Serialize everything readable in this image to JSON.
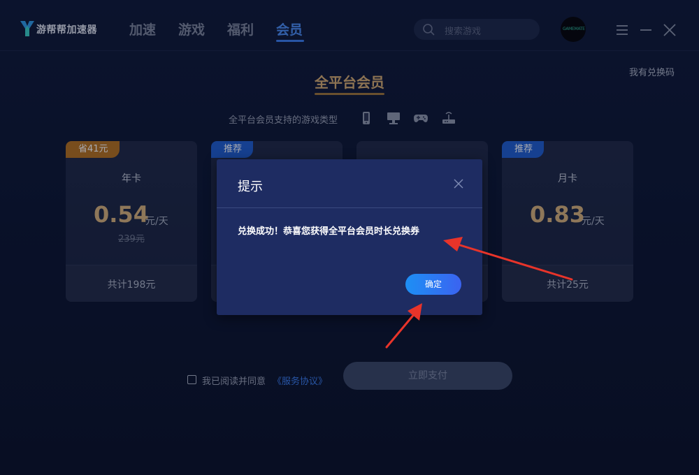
{
  "app": {
    "title": "游帮帮加速器",
    "logo_icon": "logo-y-icon"
  },
  "nav": {
    "items": [
      {
        "label": "加速",
        "active": false
      },
      {
        "label": "游戏",
        "active": false
      },
      {
        "label": "福利",
        "active": false
      },
      {
        "label": "会员",
        "active": true
      }
    ]
  },
  "search": {
    "placeholder": "搜索游戏",
    "icon": "search-icon"
  },
  "avatar": {
    "text": "GAMEMATE"
  },
  "window_controls": [
    "menu-icon",
    "minimize-icon",
    "close-icon"
  ],
  "page": {
    "redeem_link": "我有兑换码",
    "title": "全平台会员",
    "support_text": "全平台会员支持的游戏类型",
    "support_icons": [
      "mobile-icon",
      "pc-icon",
      "gamepad-icon",
      "router-icon"
    ]
  },
  "plans": [
    {
      "badge": "省41元",
      "name": "年卡",
      "price": "0.54",
      "unit": "元/天",
      "original": "239元",
      "total": "共计198元"
    },
    {
      "badge": "推荐",
      "name": "",
      "price": "",
      "unit": "",
      "original": "",
      "total": ""
    },
    {
      "badge": "",
      "name": "",
      "price": "",
      "unit": "",
      "original": "",
      "total": ""
    },
    {
      "badge": "推荐",
      "name": "月卡",
      "price": "0.83",
      "unit": "元/天",
      "original": "",
      "total": "共计25元"
    }
  ],
  "agreement": {
    "text": "我已阅读并同意",
    "link": "《服务协议》",
    "checked": false
  },
  "pay_button": "立即支付",
  "dialog": {
    "title": "提示",
    "message": "兑换成功！恭喜您获得全平台会员时长兑换券",
    "confirm": "确定"
  },
  "colors": {
    "accent": "#3b7ff0",
    "gold": "#d7b27c",
    "annotation": "#e8342a"
  }
}
